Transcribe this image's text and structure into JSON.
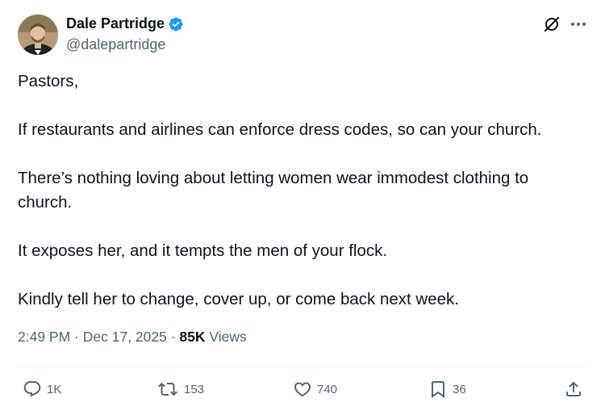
{
  "author": {
    "display_name": "Dale Partridge",
    "handle": "@dalepartridge",
    "verified": true
  },
  "icons": {
    "verified": "verified-badge-icon",
    "grok": "grok-icon",
    "more": "more-icon",
    "reply": "reply-icon",
    "retweet": "retweet-icon",
    "like": "like-icon",
    "bookmark": "bookmark-icon",
    "share": "share-icon"
  },
  "tweet": {
    "paragraphs": [
      "Pastors,",
      "If restaurants and airlines can enforce dress codes, so can your church.",
      "There’s nothing loving about letting women wear immodest clothing to church.",
      "It exposes her, and it tempts the men of your flock.",
      "Kindly tell her to change, cover up, or come back next week."
    ]
  },
  "meta": {
    "time": "2:49 PM",
    "separator": " · ",
    "date": "Dec 17, 2025",
    "views_count": "85K",
    "views_label": " Views"
  },
  "actions": {
    "replies": "1K",
    "retweets": "153",
    "likes": "740",
    "bookmarks": "36"
  },
  "colors": {
    "text": "#0f1419",
    "secondary": "#536471",
    "verified": "#1d9bf0",
    "divider": "#eff3f4"
  }
}
